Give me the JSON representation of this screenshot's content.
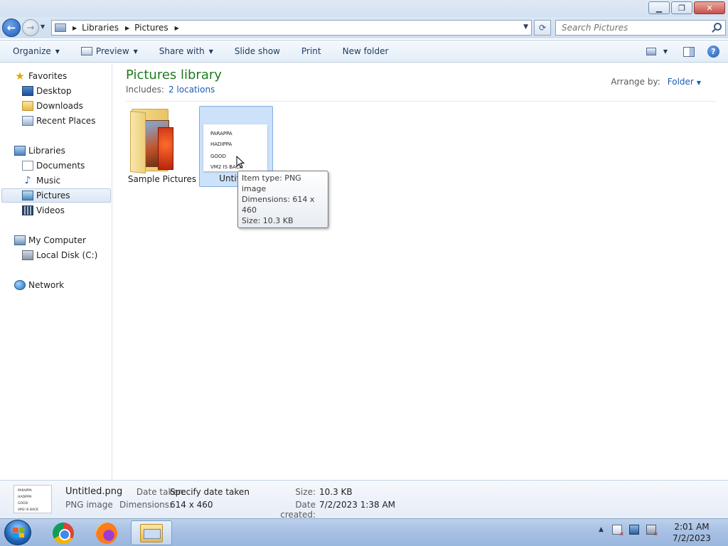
{
  "window": {
    "minimize_glyph": "▁",
    "restore_glyph": "❐",
    "close_glyph": "✕"
  },
  "address": {
    "crumbs": [
      "Libraries",
      "Pictures"
    ],
    "separator_glyph": "▶",
    "dropdown_glyph": "▼",
    "refresh_glyph": "⟳",
    "back_glyph": "←",
    "forward_glyph": "→",
    "history_glyph": "▼"
  },
  "search": {
    "placeholder": "Search Pictures"
  },
  "toolbar": {
    "organize": "Organize",
    "preview": "Preview",
    "share_with": "Share with",
    "slide_show": "Slide show",
    "print": "Print",
    "new_folder": "New folder",
    "caret_glyph": "▼",
    "help_glyph": "?"
  },
  "nav": {
    "favorites": "Favorites",
    "desktop": "Desktop",
    "downloads": "Downloads",
    "recent_places": "Recent Places",
    "libraries": "Libraries",
    "documents": "Documents",
    "music": "Music",
    "pictures": "Pictures",
    "videos": "Videos",
    "my_computer": "My Computer",
    "local_disk": "Local Disk (C:)",
    "network": "Network",
    "star_glyph": "★",
    "music_glyph": "♪"
  },
  "library": {
    "title": "Pictures library",
    "includes_label": "Includes:",
    "includes_link": "2 locations",
    "arrange_label": "Arrange by:",
    "arrange_value": "Folder"
  },
  "items": {
    "sample_pictures": "Sample Pictures",
    "untitled": "Untitled",
    "thumb_lines": [
      "PARAPPA",
      "HADIPPA",
      "GOOD",
      "VM2 IS BACK"
    ]
  },
  "tooltip": {
    "type": "Item type: PNG image",
    "dimensions": "Dimensions: 614 x 460",
    "size": "Size: 10.3 KB"
  },
  "details": {
    "name": "Untitled.png",
    "type": "PNG image",
    "date_taken_label": "Date taken:",
    "date_taken_value": "Specify date taken",
    "dimensions_label": "Dimensions:",
    "dimensions_value": "614 x 460",
    "size_label": "Size:",
    "size_value": "10.3 KB",
    "date_created_label": "Date created:",
    "date_created_value": "7/2/2023 1:38 AM"
  },
  "taskbar": {
    "apps": [
      "chrome-icon",
      "firefox-icon",
      "explorer-icon"
    ],
    "tray_up_glyph": "▲",
    "time": "2:01 AM",
    "date": "7/2/2023"
  }
}
